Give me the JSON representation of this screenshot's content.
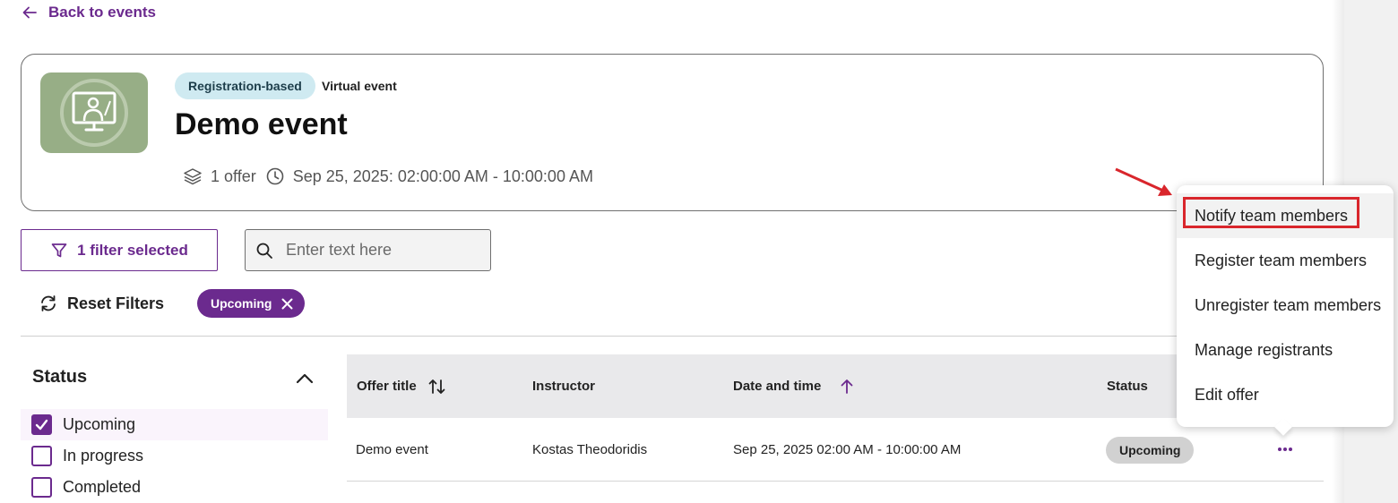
{
  "back_link": {
    "label": "Back to events"
  },
  "event": {
    "badge_type": "Registration-based",
    "badge_format": "Virtual event",
    "title": "Demo event",
    "offer_count": "1 offer",
    "datetime": "Sep 25, 2025: 02:00:00 AM - 10:00:00 AM"
  },
  "filters": {
    "filter_button": "1 filter selected",
    "search_placeholder": "Enter text here",
    "reset_label": "Reset Filters",
    "active_chip": "Upcoming"
  },
  "status_panel": {
    "heading": "Status",
    "options": [
      {
        "label": "Upcoming",
        "checked": true
      },
      {
        "label": "In progress",
        "checked": false
      },
      {
        "label": "Completed",
        "checked": false
      }
    ]
  },
  "table": {
    "columns": [
      "Offer title",
      "Instructor",
      "Date and time",
      "Status"
    ],
    "rows": [
      {
        "offer_title": "Demo event",
        "instructor": "Kostas Theodoridis",
        "date_time": "Sep 25, 2025 02:00 AM - 10:00:00 AM",
        "status": "Upcoming"
      }
    ]
  },
  "row_menu": {
    "items": [
      "Notify team members",
      "Register team members",
      "Unregister team members",
      "Manage registrants",
      "Edit offer"
    ],
    "highlighted_item": "Notify team members"
  },
  "colors": {
    "accent": "#6b2a8e",
    "badge_bg": "#cfeaf1",
    "annotation_red": "#d9262c",
    "header_bg": "#e9e9eb"
  },
  "icons": {
    "back": "arrow-left-icon",
    "thumbnail": "virtual-classroom-icon",
    "offers": "layers-icon",
    "time": "clock-icon",
    "filter": "funnel-icon",
    "search": "search-icon",
    "reset": "refresh-icon",
    "chip_remove": "close-icon",
    "collapse": "chevron-up-icon",
    "sort": "sort-arrows-icon",
    "sort_asc": "arrow-up-icon",
    "more": "more-horizontal-icon"
  }
}
